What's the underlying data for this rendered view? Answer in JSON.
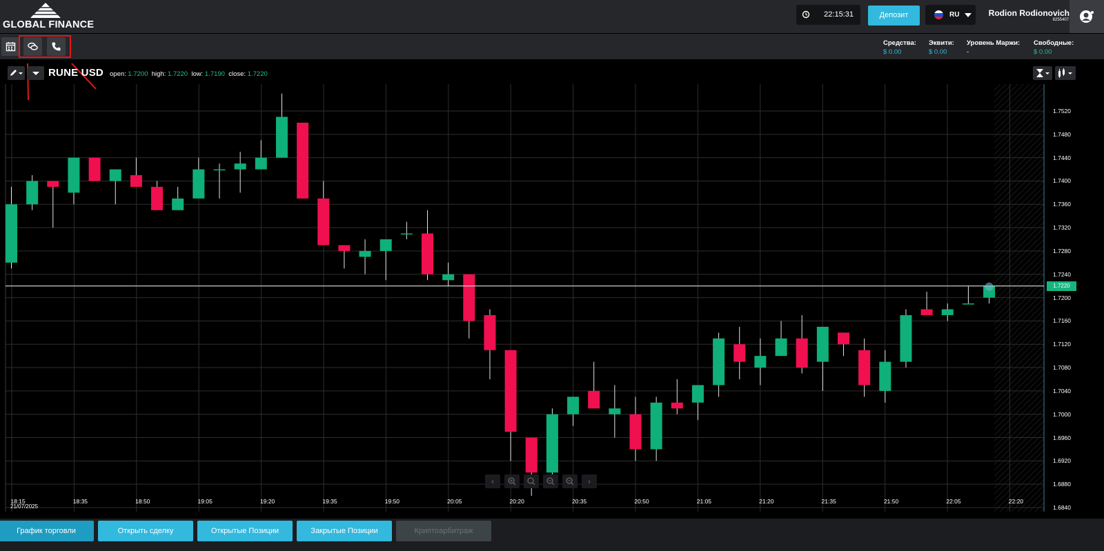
{
  "header": {
    "logo_text": "GLOBAL FINANCE",
    "clock": "22:15:31",
    "deposit_label": "Депозит",
    "language": "RU",
    "user_name": "Rodion Rodionovich",
    "user_id": "8255407"
  },
  "toolbar": {
    "buttons": [
      "calendar-icon",
      "chat-icon",
      "phone-icon"
    ]
  },
  "account": {
    "funds_label": "Средства:",
    "funds_value": "$ 0.00",
    "equity_label": "Эквити:",
    "equity_value": "$ 0.00",
    "margin_label": "Уровень Маржи:",
    "margin_value": "-",
    "free_label": "Свободные:",
    "free_value": "$ 0.00"
  },
  "chart_header": {
    "pair": "RUNE USD",
    "open_label": "open:",
    "open": "1.7200",
    "high_label": "high:",
    "high": "1.7220",
    "low_label": "low:",
    "low": "1.7190",
    "close_label": "close:",
    "close": "1.7220"
  },
  "colors": {
    "up": "#0fb07a",
    "down": "#f0104f",
    "accent": "#33b8de",
    "background": "#000000"
  },
  "chart_data": {
    "type": "candlestick",
    "symbol": "RUNE USD",
    "current_price": "1.7220",
    "ylim": [
      1.684,
      1.754
    ],
    "y_ticks": [
      "1.7520",
      "1.7480",
      "1.7440",
      "1.7400",
      "1.7360",
      "1.7320",
      "1.7280",
      "1.7240",
      "1.7200",
      "1.7160",
      "1.7120",
      "1.7080",
      "1.7040",
      "1.7000",
      "1.6960",
      "1.6920",
      "1.6880",
      "1.6840"
    ],
    "x_ticks": [
      "18:15",
      "18:35",
      "18:50",
      "19:05",
      "19:20",
      "19:35",
      "19:50",
      "20:05",
      "20:20",
      "20:35",
      "20:50",
      "21:05",
      "21:20",
      "21:35",
      "21:50",
      "22:05",
      "22:20"
    ],
    "x_date": "21/07/2025",
    "candles": [
      {
        "o": 1.726,
        "h": 1.739,
        "l": 1.725,
        "c": 1.736
      },
      {
        "o": 1.736,
        "h": 1.741,
        "l": 1.735,
        "c": 1.74
      },
      {
        "o": 1.74,
        "h": 1.74,
        "l": 1.732,
        "c": 1.739
      },
      {
        "o": 1.738,
        "h": 1.744,
        "l": 1.736,
        "c": 1.744
      },
      {
        "o": 1.744,
        "h": 1.744,
        "l": 1.74,
        "c": 1.74
      },
      {
        "o": 1.74,
        "h": 1.742,
        "l": 1.736,
        "c": 1.742
      },
      {
        "o": 1.741,
        "h": 1.744,
        "l": 1.739,
        "c": 1.739
      },
      {
        "o": 1.739,
        "h": 1.74,
        "l": 1.735,
        "c": 1.735
      },
      {
        "o": 1.735,
        "h": 1.739,
        "l": 1.735,
        "c": 1.737
      },
      {
        "o": 1.737,
        "h": 1.744,
        "l": 1.737,
        "c": 1.742
      },
      {
        "o": 1.742,
        "h": 1.743,
        "l": 1.737,
        "c": 1.742
      },
      {
        "o": 1.742,
        "h": 1.745,
        "l": 1.738,
        "c": 1.743
      },
      {
        "o": 1.742,
        "h": 1.747,
        "l": 1.742,
        "c": 1.744
      },
      {
        "o": 1.744,
        "h": 1.755,
        "l": 1.744,
        "c": 1.751
      },
      {
        "o": 1.75,
        "h": 1.75,
        "l": 1.737,
        "c": 1.737
      },
      {
        "o": 1.737,
        "h": 1.74,
        "l": 1.729,
        "c": 1.729
      },
      {
        "o": 1.729,
        "h": 1.729,
        "l": 1.725,
        "c": 1.728
      },
      {
        "o": 1.727,
        "h": 1.73,
        "l": 1.724,
        "c": 1.728
      },
      {
        "o": 1.728,
        "h": 1.73,
        "l": 1.723,
        "c": 1.73
      },
      {
        "o": 1.731,
        "h": 1.733,
        "l": 1.73,
        "c": 1.731
      },
      {
        "o": 1.731,
        "h": 1.735,
        "l": 1.723,
        "c": 1.724
      },
      {
        "o": 1.723,
        "h": 1.726,
        "l": 1.722,
        "c": 1.724
      },
      {
        "o": 1.724,
        "h": 1.724,
        "l": 1.713,
        "c": 1.716
      },
      {
        "o": 1.717,
        "h": 1.718,
        "l": 1.706,
        "c": 1.711
      },
      {
        "o": 1.711,
        "h": 1.711,
        "l": 1.692,
        "c": 1.697
      },
      {
        "o": 1.696,
        "h": 1.696,
        "l": 1.686,
        "c": 1.69
      },
      {
        "o": 1.69,
        "h": 1.701,
        "l": 1.688,
        "c": 1.7
      },
      {
        "o": 1.7,
        "h": 1.703,
        "l": 1.698,
        "c": 1.703
      },
      {
        "o": 1.704,
        "h": 1.709,
        "l": 1.701,
        "c": 1.701
      },
      {
        "o": 1.7,
        "h": 1.705,
        "l": 1.696,
        "c": 1.701
      },
      {
        "o": 1.7,
        "h": 1.703,
        "l": 1.692,
        "c": 1.694
      },
      {
        "o": 1.694,
        "h": 1.703,
        "l": 1.692,
        "c": 1.702
      },
      {
        "o": 1.702,
        "h": 1.706,
        "l": 1.7,
        "c": 1.701
      },
      {
        "o": 1.702,
        "h": 1.705,
        "l": 1.699,
        "c": 1.705
      },
      {
        "o": 1.705,
        "h": 1.714,
        "l": 1.703,
        "c": 1.713
      },
      {
        "o": 1.712,
        "h": 1.715,
        "l": 1.706,
        "c": 1.709
      },
      {
        "o": 1.708,
        "h": 1.713,
        "l": 1.705,
        "c": 1.71
      },
      {
        "o": 1.71,
        "h": 1.716,
        "l": 1.71,
        "c": 1.713
      },
      {
        "o": 1.713,
        "h": 1.717,
        "l": 1.707,
        "c": 1.708
      },
      {
        "o": 1.709,
        "h": 1.715,
        "l": 1.704,
        "c": 1.715
      },
      {
        "o": 1.714,
        "h": 1.714,
        "l": 1.71,
        "c": 1.712
      },
      {
        "o": 1.711,
        "h": 1.713,
        "l": 1.703,
        "c": 1.705
      },
      {
        "o": 1.704,
        "h": 1.711,
        "l": 1.702,
        "c": 1.709
      },
      {
        "o": 1.709,
        "h": 1.718,
        "l": 1.708,
        "c": 1.717
      },
      {
        "o": 1.718,
        "h": 1.721,
        "l": 1.717,
        "c": 1.717
      },
      {
        "o": 1.717,
        "h": 1.719,
        "l": 1.716,
        "c": 1.718
      },
      {
        "o": 1.719,
        "h": 1.722,
        "l": 1.719,
        "c": 1.719
      },
      {
        "o": 1.72,
        "h": 1.722,
        "l": 1.719,
        "c": 1.722
      }
    ]
  },
  "bottom_tabs": [
    {
      "label": "График торговли"
    },
    {
      "label": "Открыть сделку"
    },
    {
      "label": "Открытые Позиции"
    },
    {
      "label": "Закрытые Позиции"
    },
    {
      "label": "Криптоарбитраж"
    }
  ]
}
